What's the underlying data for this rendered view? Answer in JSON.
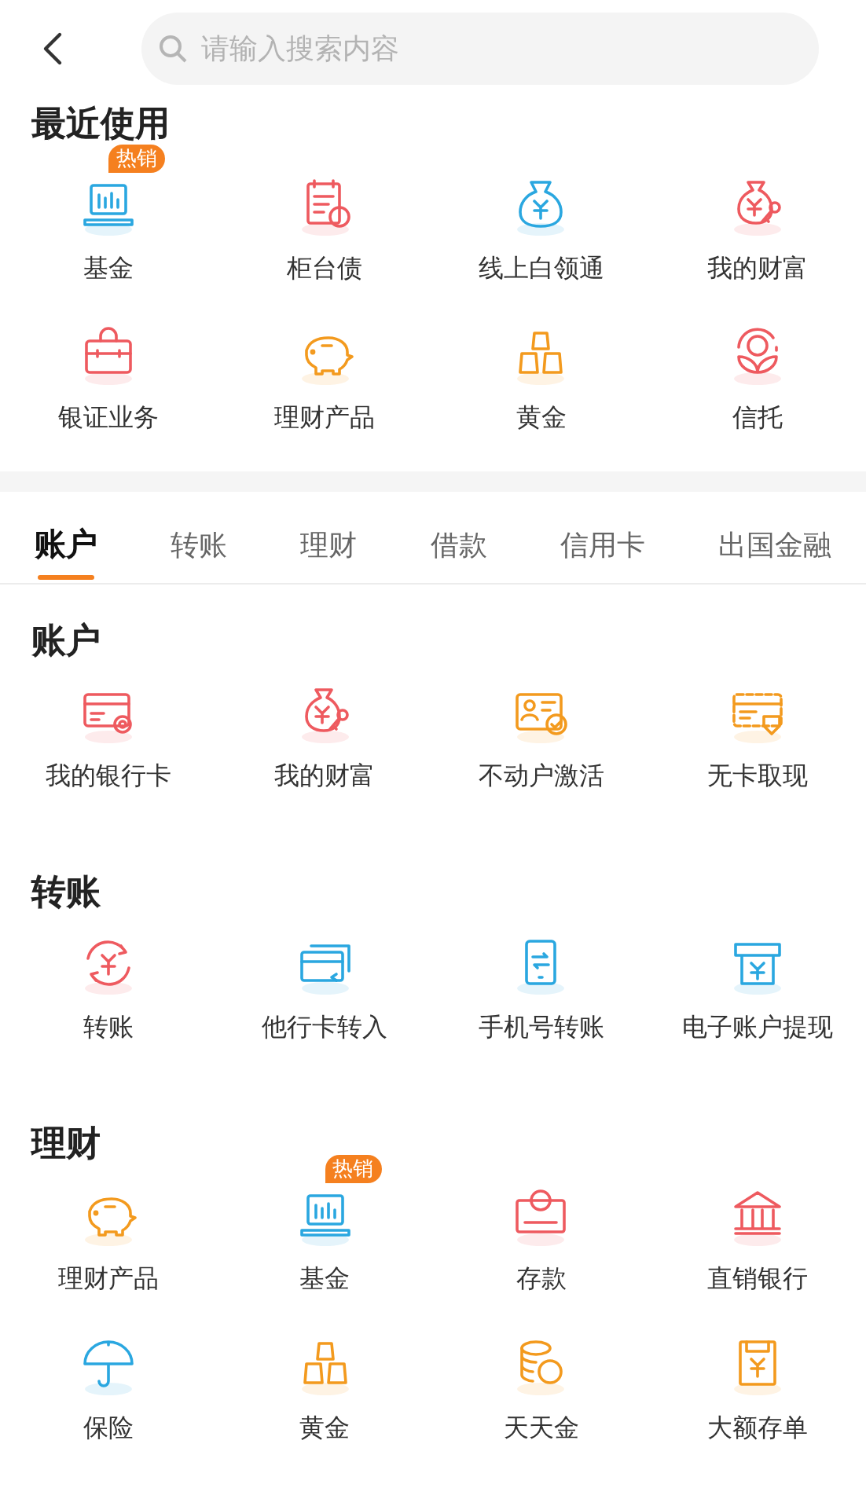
{
  "search": {
    "placeholder": "请输入搜索内容"
  },
  "recent": {
    "title": "最近使用",
    "items": [
      {
        "label": "基金",
        "kind": "laptop",
        "color": "#2aa7e0",
        "badge": "热销"
      },
      {
        "label": "柜台债",
        "kind": "document",
        "color": "#ee5a5f"
      },
      {
        "label": "线上白领通",
        "kind": "bag",
        "color": "#2aa7e0"
      },
      {
        "label": "我的财富",
        "kind": "bag-key",
        "color": "#ee5a5f"
      },
      {
        "label": "银证业务",
        "kind": "briefcase",
        "color": "#ee5a5f"
      },
      {
        "label": "理财产品",
        "kind": "piggy",
        "color": "#f39a1e"
      },
      {
        "label": "黄金",
        "kind": "gold",
        "color": "#f39a1e"
      },
      {
        "label": "信托",
        "kind": "leaf",
        "color": "#ee5a5f"
      }
    ]
  },
  "tabs": [
    {
      "label": "账户",
      "selected": true
    },
    {
      "label": "转账",
      "selected": false
    },
    {
      "label": "理财",
      "selected": false
    },
    {
      "label": "借款",
      "selected": false
    },
    {
      "label": "信用卡",
      "selected": false
    },
    {
      "label": "出国金融",
      "selected": false
    }
  ],
  "sections": [
    {
      "title": "账户",
      "items": [
        {
          "label": "我的银行卡",
          "kind": "card-gear",
          "color": "#ee5a5f"
        },
        {
          "label": "我的财富",
          "kind": "bag-key",
          "color": "#ee5a5f"
        },
        {
          "label": "不动户激活",
          "kind": "id-check",
          "color": "#f39a1e"
        },
        {
          "label": "无卡取现",
          "kind": "card-down",
          "color": "#f39a1e"
        }
      ]
    },
    {
      "title": "转账",
      "items": [
        {
          "label": "转账",
          "kind": "exchange",
          "color": "#ee5a5f"
        },
        {
          "label": "他行卡转入",
          "kind": "cards",
          "color": "#2aa7e0"
        },
        {
          "label": "手机号转账",
          "kind": "phone",
          "color": "#2aa7e0"
        },
        {
          "label": "电子账户提现",
          "kind": "atm",
          "color": "#2aa7e0"
        }
      ]
    },
    {
      "title": "理财",
      "items": [
        {
          "label": "理财产品",
          "kind": "piggy",
          "color": "#f39a1e"
        },
        {
          "label": "基金",
          "kind": "laptop",
          "color": "#2aa7e0",
          "badge": "热销"
        },
        {
          "label": "存款",
          "kind": "deposit",
          "color": "#ee5a5f"
        },
        {
          "label": "直销银行",
          "kind": "bank",
          "color": "#ee5a5f"
        },
        {
          "label": "保险",
          "kind": "umbrella",
          "color": "#2aa7e0"
        },
        {
          "label": "黄金",
          "kind": "gold",
          "color": "#f39a1e"
        },
        {
          "label": "天天金",
          "kind": "coins",
          "color": "#f39a1e"
        },
        {
          "label": "大额存单",
          "kind": "certificate",
          "color": "#f39a1e"
        }
      ]
    }
  ]
}
